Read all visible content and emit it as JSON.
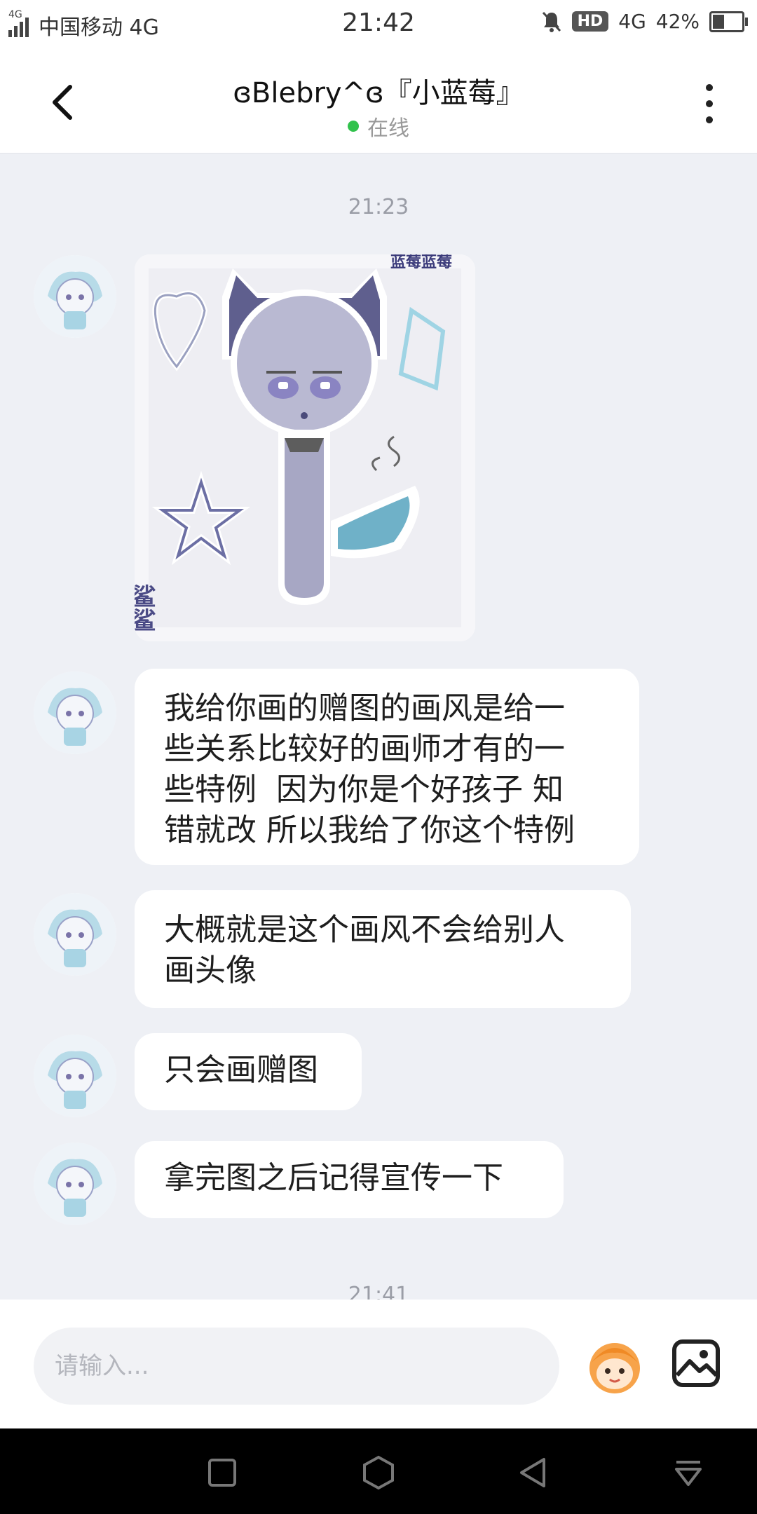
{
  "status_bar": {
    "network_small": "4G",
    "carrier": "中国移动 4G",
    "time": "21:42",
    "hd": "HD",
    "net": "4G",
    "battery": "42%"
  },
  "header": {
    "title": "ɞBlebry^ɞ『小蓝莓』",
    "status": "在线",
    "status_color": "#31c24c"
  },
  "chat": {
    "timestamps": [
      "21:23",
      "21:41"
    ],
    "messages": [
      {
        "type": "image",
        "sticker_text_top": "蓝莓蓝莓",
        "sticker_text_side": "鲨鲨"
      },
      {
        "type": "text",
        "lines": [
          "我给你画的赠图的画风是给一",
          "些关系比较好的画师才有的一",
          "些特例  因为你是个好孩子 知",
          "错就改 所以我给了你这个特例"
        ]
      },
      {
        "type": "text",
        "lines": [
          "大概就是这个画风不会给别人",
          "画头像"
        ]
      },
      {
        "type": "text",
        "lines": [
          "只会画赠图"
        ]
      },
      {
        "type": "text",
        "lines": [
          "拿完图之后记得宣传一下"
        ]
      }
    ]
  },
  "input": {
    "placeholder": "请输入..."
  },
  "icons": {
    "back": "back-arrow-icon",
    "more": "more-vertical-icon",
    "emoji": "mascot-emoji-icon",
    "image": "image-icon",
    "nav": [
      "square-icon",
      "hexagon-icon",
      "triangle-back-icon",
      "dropdown-icon"
    ]
  },
  "colors": {
    "background": "#eef0f5",
    "bubble": "#ffffff",
    "online": "#31c24c"
  }
}
